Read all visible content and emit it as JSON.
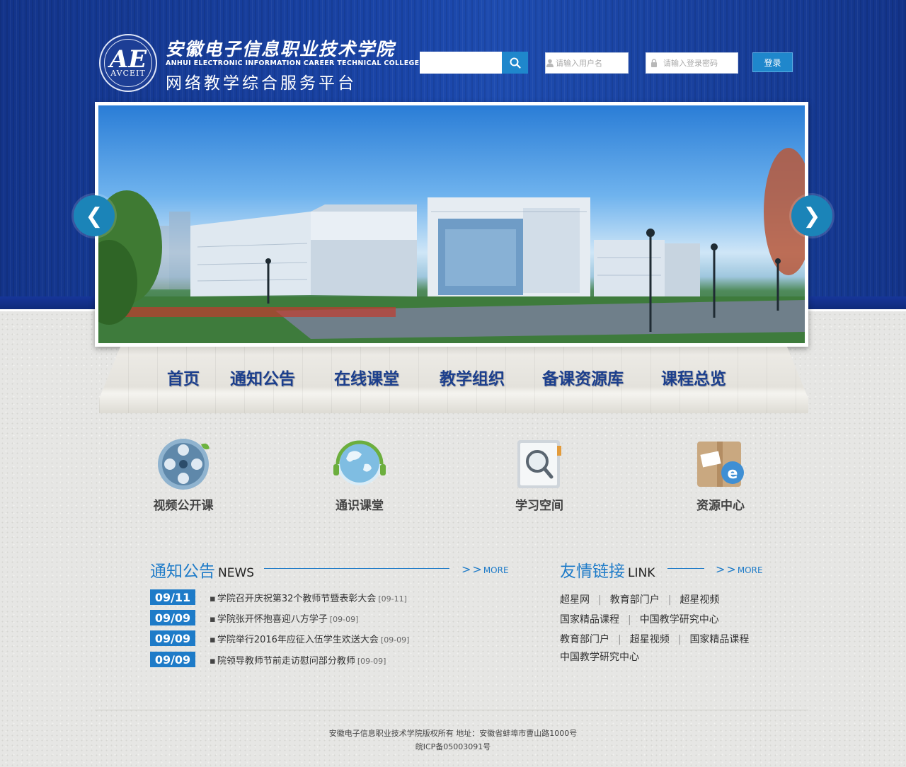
{
  "header": {
    "logo_cn": "安徽电子信息职业技术学院",
    "logo_en": "ANHUI ELECTRONIC INFORMATION CAREER TECHNICAL COLLEGE",
    "platform_name": "网络教学综合服务平台",
    "seal_text": "AVCEIT",
    "seal_mark": "AE"
  },
  "search": {
    "placeholder": "",
    "icon": "search-icon"
  },
  "login": {
    "username_placeholder": "请输入用户名",
    "password_placeholder": "请输入登录密码",
    "button": "登录"
  },
  "banner": {
    "prev": "❮",
    "next": "❯"
  },
  "nav": {
    "items": [
      "首页",
      "通知公告",
      "在线课堂",
      "教学组织",
      "备课资源库",
      "课程总览"
    ]
  },
  "features": [
    {
      "label": "视频公开课",
      "icon": "film-reel-icon"
    },
    {
      "label": "通识课堂",
      "icon": "globe-icon"
    },
    {
      "label": "学习空间",
      "icon": "magnifier-document-icon"
    },
    {
      "label": "资源中心",
      "icon": "box-ie-icon"
    }
  ],
  "news": {
    "title_cn": "通知公告",
    "title_en": "NEWS",
    "more_arrows": ">>",
    "more": "MORE",
    "items": [
      {
        "date": "09/11",
        "title": "学院召开庆祝第32个教师节暨表彰大会",
        "date2": "[09-11]"
      },
      {
        "date": "09/09",
        "title": "学院张开怀抱喜迎八方学子",
        "date2": "[09-09]"
      },
      {
        "date": "09/09",
        "title": "学院举行2016年应征入伍学生欢送大会",
        "date2": "[09-09]"
      },
      {
        "date": "09/09",
        "title": "院领导教师节前走访慰问部分教师",
        "date2": "[09-09]"
      }
    ]
  },
  "links": {
    "title_cn": "友情链接",
    "title_en": "LINK",
    "more_arrows": ">>",
    "more": "MORE",
    "rows": [
      [
        "超星网",
        "教育部门户",
        "超星视频"
      ],
      [
        "国家精品课程",
        "中国教学研究中心"
      ],
      [
        "教育部门户",
        "超星视频",
        "国家精品课程"
      ],
      [
        "中国教学研究中心"
      ]
    ]
  },
  "footer": {
    "line1": "安徽电子信息职业技术学院版权所有   地址：安徽省蚌埠市曹山路1000号",
    "line2": "皖ICP备05003091号"
  },
  "colors": {
    "brand_blue": "#1a45a8",
    "accent": "#1e7bc8",
    "nav_text": "#1c3f8d"
  }
}
